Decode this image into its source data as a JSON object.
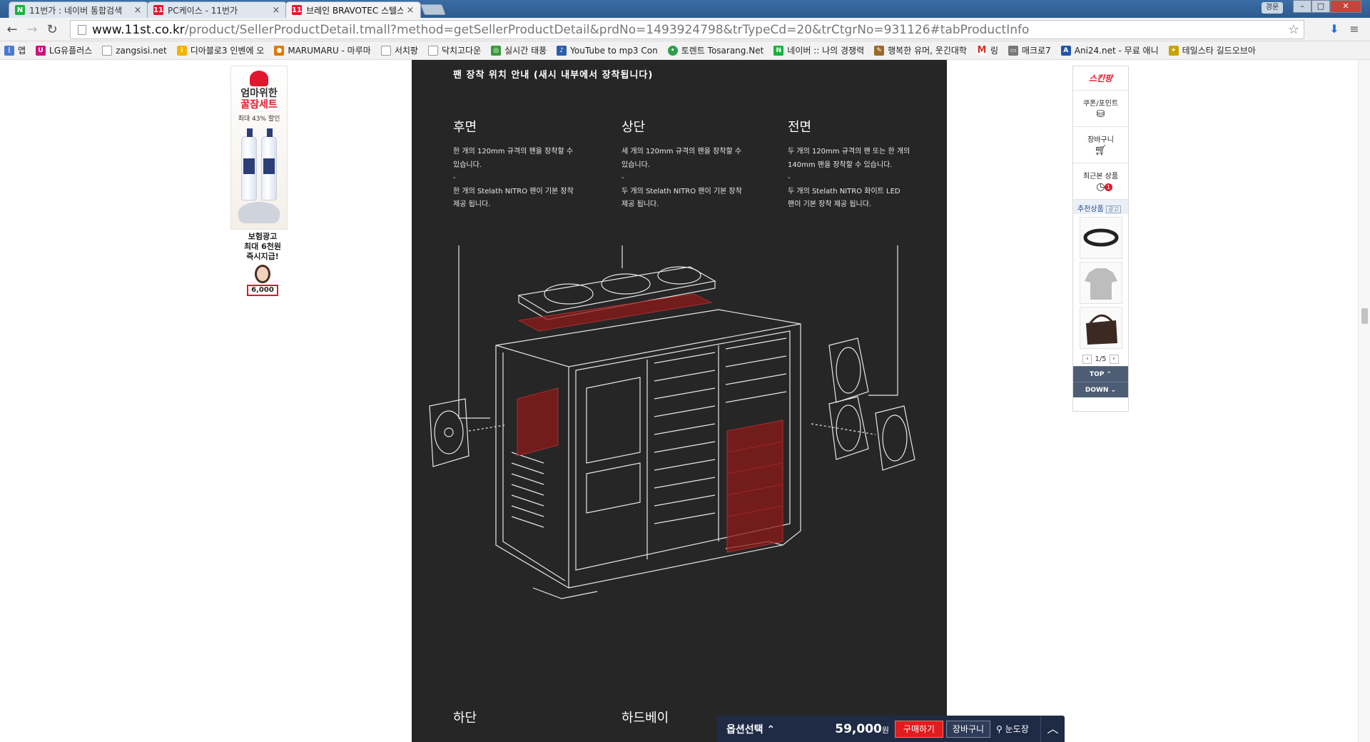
{
  "browser": {
    "tabs": [
      {
        "label": "11번가 : 네이버 통합검색",
        "icon": "naver-n-icon",
        "active": false
      },
      {
        "label": "PC케이스 - 11번가",
        "icon": "11st-icon",
        "active": false
      },
      {
        "label": "브레인 BRAVOTEC 스텔스",
        "icon": "11st-icon",
        "active": true
      }
    ],
    "user_badge": "경운",
    "url_host": "www.11st.co.kr",
    "url_path": "/product/SellerProductDetail.tmall?method=getSellerProductDetail&prdNo=1493924798&trTypeCd=20&trCtgrNo=931126#tabProductInfo",
    "bookmarks": [
      {
        "label": "앱",
        "icon": "apps-grid-icon"
      },
      {
        "label": "LG유플러스",
        "icon": "lg-uplus-icon"
      },
      {
        "label": "zangsisi.net",
        "icon": "page-icon"
      },
      {
        "label": "디아블로3 인벤에 오",
        "icon": "inven-icon"
      },
      {
        "label": "MARUMARU - 마루마",
        "icon": "maru-icon"
      },
      {
        "label": "서치팡",
        "icon": "page-icon"
      },
      {
        "label": "닥치고다운",
        "icon": "page-icon"
      },
      {
        "label": "실시간 태풍",
        "icon": "typhoon-icon"
      },
      {
        "label": "YouTube to mp3 Con",
        "icon": "mp3-icon"
      },
      {
        "label": "토렌트 Tosarang.Net",
        "icon": "torrent-icon"
      },
      {
        "label": "네이버 :: 나의 경쟁력",
        "icon": "naver-n-icon"
      },
      {
        "label": "행복한 유머, 웃긴대학",
        "icon": "humor-icon"
      },
      {
        "label": "링",
        "icon": "gmail-icon"
      },
      {
        "label": "매크로7",
        "icon": "folder-icon"
      },
      {
        "label": "Ani24.net - 무료 애니",
        "icon": "ani24-icon"
      },
      {
        "label": "테일스타 길드오브아",
        "icon": "tales-icon"
      }
    ]
  },
  "left_ads": {
    "promo_line1": "엄마위한",
    "promo_line2": "꿀잠세트",
    "promo_line3": "최대 43% 할인",
    "insurance_line1": "보험광고",
    "insurance_line2": "최대 6천원",
    "insurance_line3": "즉시지급!",
    "insurance_amount": "6,000"
  },
  "detail": {
    "heading": "팬 장착 위치 안내 (새시 내부에서 장착됩니다)",
    "columns": [
      {
        "title": "후면",
        "lines": [
          "한 개의 120mm 규격의 팬을 장착할 수",
          "있습니다.",
          "-",
          "한 개의 Stelath NITRO 팬이 기본 장착",
          "제공 됩니다."
        ]
      },
      {
        "title": "상단",
        "lines": [
          "세 개의 120mm 규격의 팬을 장착할 수",
          "있습니다.",
          "-",
          "두 개의 Stelath NITRO 팬이 기본 장착",
          "제공 됩니다."
        ]
      },
      {
        "title": "전면",
        "lines": [
          "두 개의 120mm 규격의 팬 또는 한 개의",
          "140mm 팬을 장착할 수 있습니다.",
          "-",
          "두 개의 Stelath NITRO 화이트 LED",
          "팬이 기본 장착 제공 됩니다."
        ]
      }
    ],
    "bottom_titles": [
      "하단",
      "하드베이"
    ]
  },
  "quick_menu": {
    "logo": "스킨팡",
    "items": [
      {
        "label": "쿠폰/포인트",
        "icon": "coins-icon"
      },
      {
        "label": "장바구니",
        "icon": "cart-icon"
      },
      {
        "label": "최근본 상품",
        "icon": "clock-icon",
        "badge": "1"
      }
    ],
    "recommend_label": "추천상품",
    "ad_label": "광고",
    "pager": "1/5",
    "top_label": "TOP ⌃",
    "down_label": "DOWN ⌄"
  },
  "order_bar": {
    "option_label": "옵션선택",
    "price": "59,000",
    "currency": "원",
    "buy_label": "구매하기",
    "cart_label": "장바구니",
    "wish_label": "눈도장"
  }
}
